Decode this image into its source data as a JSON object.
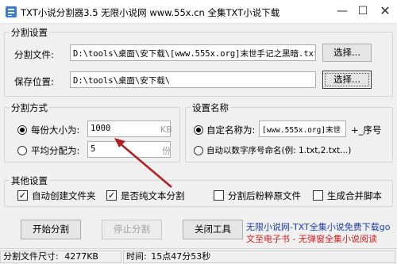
{
  "window": {
    "title": "TXT小说分割器3.5  无限小说网 www.55x.cn 全集TXT小说下载",
    "controls": {
      "minimize": "—",
      "maximize": "☐",
      "close": "✕"
    }
  },
  "split_settings": {
    "legend": "分割设置",
    "file_label": "分割文件:",
    "file_value": "D:\\tools\\桌面\\安下载\\[www.555x.org]末世手记之黑暗.txt",
    "file_browse": "选择...",
    "save_label": "保存位置:",
    "save_value": "D:\\tools\\桌面\\安下载\\",
    "save_browse": "选择..."
  },
  "split_method": {
    "legend": "分割方式",
    "by_size_label": "每份大小为:",
    "by_size_value": "1000",
    "by_size_unit": "KB",
    "by_count_label": "平均分配为:",
    "by_count_value": "5",
    "by_count_unit": "份",
    "selected": "by_size"
  },
  "naming": {
    "legend": "设置名称",
    "custom_label": "自定名称为:",
    "custom_value": "[www.555x.org]末世",
    "custom_suffix": "+_序号",
    "numeric_label": "自动以数字序号命名(例: 1.txt,2.txt...)",
    "selected": "custom"
  },
  "other_settings": {
    "legend": "其他设置",
    "options": [
      {
        "label": "自动创建文件夹",
        "checked": true
      },
      {
        "label": "是否纯文本分割",
        "checked": true
      },
      {
        "label": "分割后粉粹原文件",
        "checked": false
      },
      {
        "label": "生成合并脚本",
        "checked": false
      }
    ]
  },
  "actions": {
    "start": "开始分割",
    "stop": "停止分割",
    "close": "关闭工具"
  },
  "promo": {
    "line1": "无限小说网-TXT全集小说免费下载go",
    "line2": "文至电子书 - 无弹窗全集小说阅读"
  },
  "status": {
    "size_label": "分割文件尺寸:",
    "size_value": "4277KB",
    "time_label": "时间:",
    "time_value": "15点47分53秒"
  },
  "colors": {
    "accent_blue": "#1a3ea8",
    "promo_red": "#d42020",
    "arrow": "#b02020"
  }
}
